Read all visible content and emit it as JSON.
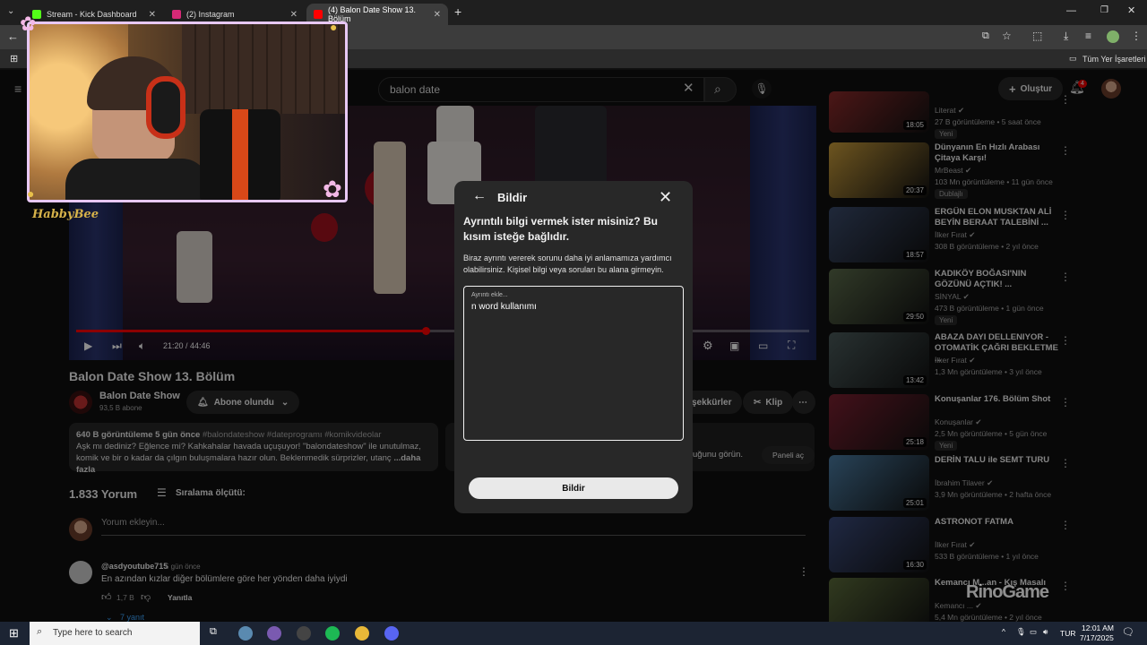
{
  "browser": {
    "tabs": [
      {
        "label": "Stream - Kick Dashboard",
        "color": "#53fc18"
      },
      {
        "label": "(2) Instagram",
        "color": "#d62976"
      },
      {
        "label": "(4) Balon Date Show 13. Bölüm",
        "color": "#ff0000"
      }
    ],
    "bookmarks_all": "Tüm Yer İşaretleri"
  },
  "youtube": {
    "search_value": "balon date",
    "create_label": "Oluştur",
    "notif_count": "4",
    "player": {
      "time": "21:20 / 44:46",
      "progress_fraction": 0.477
    },
    "video_title": "Balon Date Show 13. Bölüm",
    "channel_name": "Balon Date Show",
    "channel_subs": "93,5 B abone",
    "subscribed_label": "Abone olundu",
    "thanks_label": "şekkürler",
    "clip_label": "Klip",
    "desc_stats": "640 B görüntüleme  5 gün önce",
    "desc_tags": "#balondateshow #dateprogramı #komikvideolar",
    "desc_line1": "Aşk mı dediniz? Eğlence mi? Kahkahalar havada uçuşuyor! \"balondateshow\" ile unutulmaz,",
    "desc_line2": "komik ve bir o kadar da çılgın buluşmalara hazır olun. Beklenmedik sürprizler, utanç",
    "desc_more": "...daha fazla",
    "side_panel_text": "uğunu görün.",
    "side_panel_button": "Paneli aç",
    "comments_count": "1.833 Yorum",
    "sort_label": "Sıralama ölçütü:",
    "add_comment_placeholder": "Yorum ekleyin...",
    "comment": {
      "author": "@asdyoutube715",
      "time": "5 gün önce",
      "text": "En azından kızlar diğer bölümlere göre her yönden daha iyiydi",
      "likes": "1,7 B",
      "reply_label": "Yanıtla",
      "replies_label": "7 yanıt"
    }
  },
  "recommendations": [
    {
      "title": "",
      "channel": "Literat",
      "meta": "27 B görüntüleme • 5 saat önce",
      "badge": "Yeni",
      "duration": "18:05",
      "thumb": "#8a2a2a"
    },
    {
      "title": "Dünyanın En Hızlı Arabası Çitaya Karşı!",
      "channel": "MrBeast",
      "meta": "103 Mn görüntüleme • 11 gün önce",
      "badge": "Dublajlı",
      "duration": "20:37",
      "thumb": "#c69a3a"
    },
    {
      "title": "ERGÜN ELON MUSKTAN ALİ BEYİN BERAAT TALEBİNİ ...",
      "channel": "İlker Fırat",
      "meta": "308 B görüntüleme • 2 yıl önce",
      "badge": "",
      "duration": "18:57",
      "thumb": "#3a4a6a"
    },
    {
      "title": "KADIKÖY BOĞASI'NIN GÖZÜNÜ AÇTIK! ...",
      "channel": "SİNYAL",
      "meta": "473 B görüntüleme • 1 gün önce",
      "badge": "Yeni",
      "duration": "29:50",
      "thumb": "#5a6a4a"
    },
    {
      "title": "ABAZA DAYI DELLENIYOR - OTOMATİK ÇAĞRI BEKLETME ...",
      "channel": "İlker Fırat",
      "meta": "1,3 Mn görüntüleme • 3 yıl önce",
      "badge": "",
      "duration": "13:42",
      "thumb": "#4a5a5a"
    },
    {
      "title": "Konuşanlar 176. Bölüm Shot",
      "channel": "Konuşanlar",
      "meta": "2,5 Mn görüntüleme • 5 gün önce",
      "badge": "Yeni",
      "duration": "25:18",
      "thumb": "#7a2030"
    },
    {
      "title": "DERİN TALU ile SEMT TURU",
      "channel": "İbrahim Tilaver",
      "meta": "3,9 Mn görüntüleme • 2 hafta önce",
      "badge": "",
      "duration": "25:01",
      "thumb": "#4a7aa0"
    },
    {
      "title": "ASTRONOT FATMA",
      "channel": "İlker Fırat",
      "meta": "533 B görüntüleme • 1 yıl önce",
      "badge": "",
      "duration": "16:30",
      "thumb": "#3a4a7a"
    },
    {
      "title": "Kemancı M...an - Kış Masalı",
      "channel": "Kemancı ...",
      "meta": "5,4 Mn görüntüleme • 2 yıl önce",
      "badge": "",
      "duration": "",
      "thumb": "#5a6a3a"
    }
  ],
  "dialog": {
    "title": "Bildir",
    "question": "Ayrıntılı bilgi vermek ister misiniz? Bu kısım isteğe bağlıdır.",
    "help": "Biraz ayrıntı vererek sorunu daha iyi anlamamıza yardımcı olabilirsiniz. Kişisel bilgi veya soruları bu alana girmeyin.",
    "field_label": "Ayrıntı ekle...",
    "field_value": "n word kullanımı",
    "submit_label": "Bildir"
  },
  "stream_overlay": {
    "name": "HabbyBee"
  },
  "watermark": "RinoGame",
  "taskbar": {
    "search_placeholder": "Type here to search",
    "lang": "TUR",
    "time": "12:01 AM",
    "date": "7/17/2025"
  }
}
